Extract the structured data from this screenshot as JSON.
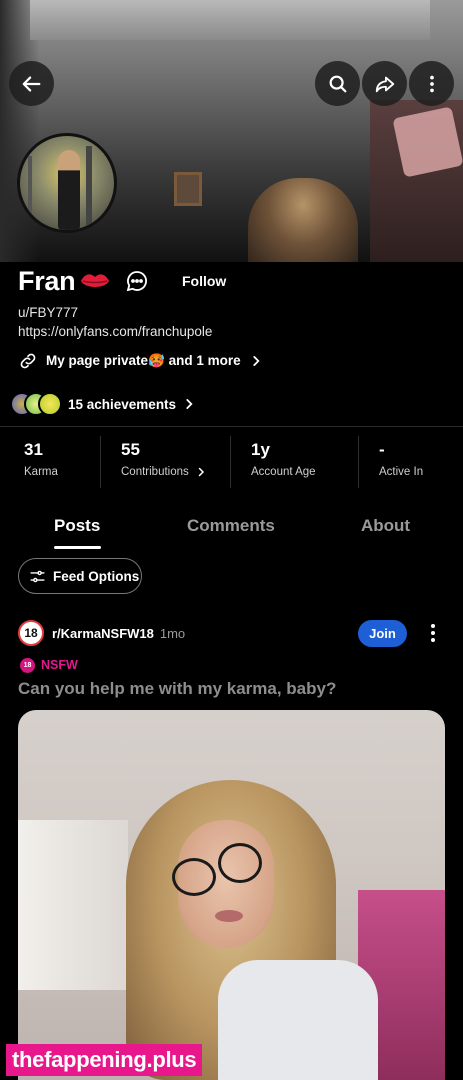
{
  "profile": {
    "display_name": "Fran",
    "username": "u/FBY777",
    "url": "https://onlyfans.com/franchupole",
    "follow_label": "Follow",
    "social_links_label": "My page private🥵 and 1 more",
    "achievements_label": "15 achievements"
  },
  "stats": [
    {
      "value": "31",
      "label": "Karma"
    },
    {
      "value": "55",
      "label": "Contributions"
    },
    {
      "value": "1y",
      "label": "Account Age"
    },
    {
      "value": "-",
      "label": "Active In"
    }
  ],
  "tabs": [
    {
      "label": "Posts",
      "active": true
    },
    {
      "label": "Comments",
      "active": false
    },
    {
      "label": "About",
      "active": false
    }
  ],
  "feed_options_label": "Feed Options",
  "post": {
    "subreddit": "r/KarmaNSFW18",
    "subreddit_icon_text": "18",
    "time": "1mo",
    "join_label": "Join",
    "nsfw_label": "NSFW",
    "nsfw_icon_text": "18",
    "title": "Can you help me with my karma, baby?"
  },
  "watermark": "thefappening.plus",
  "colors": {
    "join": "#1e5fd6",
    "nsfw": "#e2198e",
    "background": "#000000"
  },
  "icons": [
    "back-arrow-icon",
    "search-icon",
    "share-icon",
    "more-vertical-icon",
    "lips-icon",
    "chat-icon",
    "link-icon",
    "chevron-right-icon",
    "feed-options-icon"
  ]
}
